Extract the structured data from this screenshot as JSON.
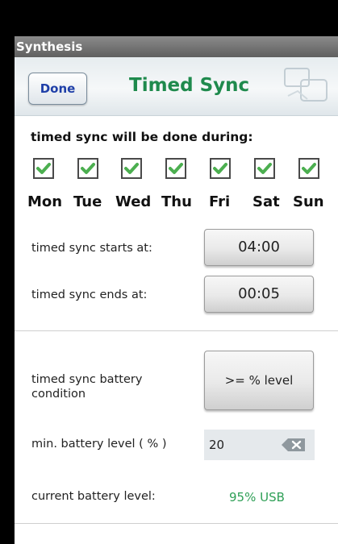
{
  "app": {
    "name": "Synthesis"
  },
  "header": {
    "done_label": "Done",
    "title": "Timed Sync"
  },
  "days_section": {
    "label": "timed sync will be done during:"
  },
  "days": [
    {
      "label": "Mon",
      "checked": true
    },
    {
      "label": "Tue",
      "checked": true
    },
    {
      "label": "Wed",
      "checked": true
    },
    {
      "label": "Thu",
      "checked": true
    },
    {
      "label": "Fri",
      "checked": true
    },
    {
      "label": "Sat",
      "checked": true
    },
    {
      "label": "Sun",
      "checked": true
    }
  ],
  "schedule": {
    "start_label": "timed sync starts at:",
    "start_value": "04:00",
    "end_label": "timed sync ends at:",
    "end_value": "00:05"
  },
  "battery": {
    "condition_label": "timed sync battery condition",
    "condition_value": ">= % level",
    "min_label": "min. battery level ( % )",
    "min_value": "20",
    "current_label": "current battery level:",
    "current_value": "95% USB"
  },
  "colors": {
    "title": "#1f8a4d",
    "done_text": "#1f3fa8",
    "check": "#4caf50",
    "battery_value": "#2e9f56"
  },
  "icons": {
    "check": "checkmark-icon",
    "clear": "backspace-clear-icon"
  }
}
